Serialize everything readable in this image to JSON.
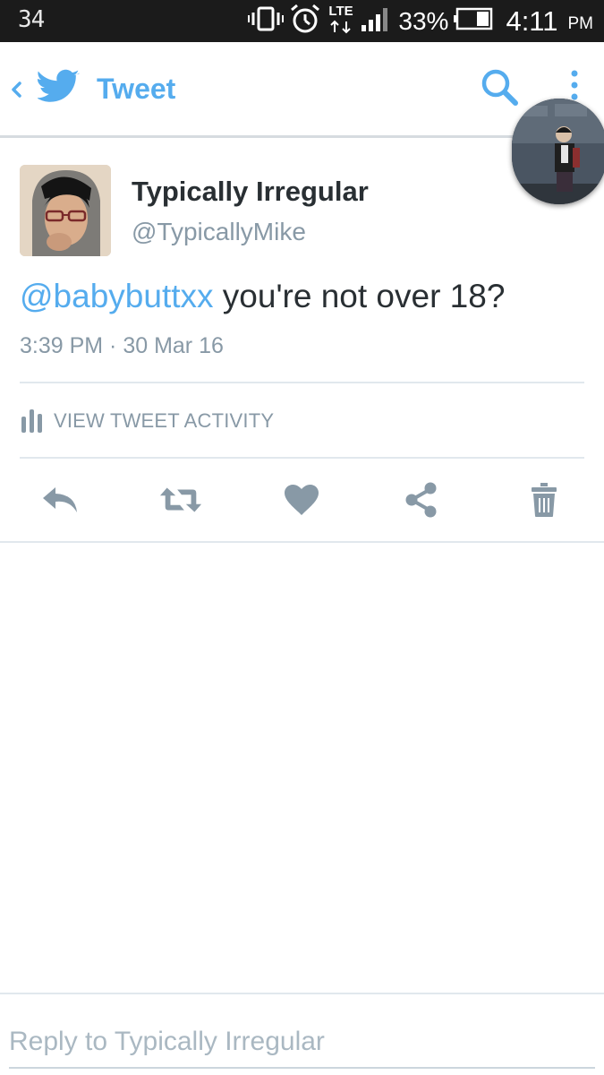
{
  "status_bar": {
    "left_text": "34",
    "network": "LTE",
    "battery_percent": "33%",
    "time": "4:11",
    "ampm": "PM"
  },
  "header": {
    "title": "Tweet",
    "accent_color": "#55acee",
    "icons": [
      "back-arrow-icon",
      "twitter-bird-icon",
      "search-icon",
      "more-vertical-icon"
    ]
  },
  "tweet": {
    "author_name": "Typically Irregular",
    "author_handle": "@TypicallyMike",
    "mention": "@babybuttxx",
    "text": " you're not over 18?",
    "timestamp": "3:39 PM · 30 Mar 16",
    "activity_label": "VIEW TWEET ACTIVITY",
    "actions": [
      "reply-icon",
      "retweet-icon",
      "like-icon",
      "share-icon",
      "delete-icon"
    ]
  },
  "reply": {
    "placeholder": "Reply to Typically Irregular"
  },
  "colors": {
    "text_primary": "#292f33",
    "text_secondary": "#8899a6",
    "action_gray": "#8899a6",
    "divider": "#e1e8ed"
  }
}
